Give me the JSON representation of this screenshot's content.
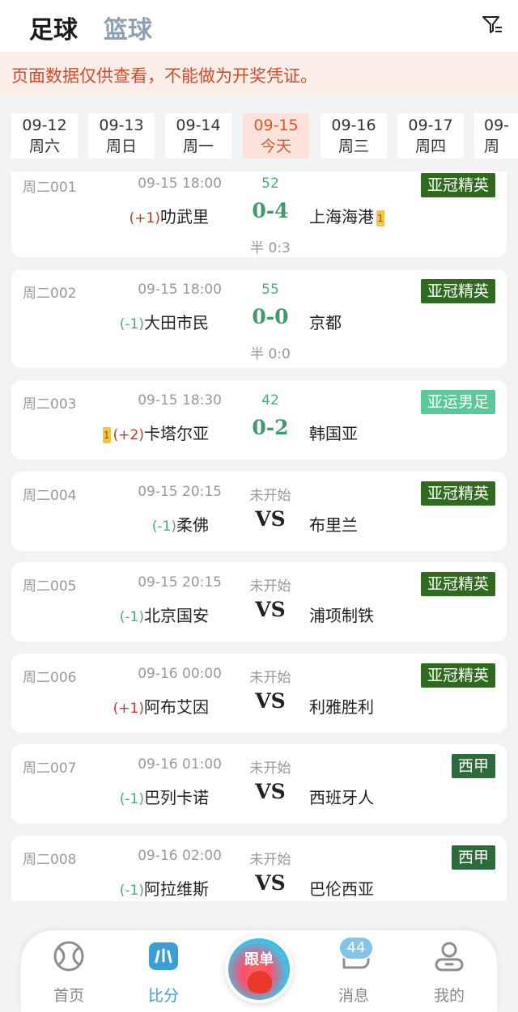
{
  "header": {
    "tab_active": "足球",
    "tab_inactive": "篮球"
  },
  "notice": "页面数据仅供查看，不能做为开奖凭证。",
  "dates": [
    {
      "date": "09-12",
      "day": "周六",
      "active": false
    },
    {
      "date": "09-13",
      "day": "周日",
      "active": false
    },
    {
      "date": "09-14",
      "day": "周一",
      "active": false
    },
    {
      "date": "09-15",
      "day": "今天",
      "active": true
    },
    {
      "date": "09-16",
      "day": "周三",
      "active": false
    },
    {
      "date": "09-17",
      "day": "周四",
      "active": false
    },
    {
      "date": "09-",
      "day": "周",
      "active": false
    }
  ],
  "matches": [
    {
      "code": "周二001",
      "time": "09-15 18:00",
      "status": "52",
      "league": "亚冠精英",
      "league_color": "#2f6b1f",
      "home_prefix_card": "",
      "handicap": "(+1)",
      "home": "叻武里",
      "score": "0-4",
      "away": "上海海港",
      "away_card": "1",
      "half": "半 0:3"
    },
    {
      "code": "周二002",
      "time": "09-15 18:00",
      "status": "55",
      "league": "亚冠精英",
      "league_color": "#2f6b1f",
      "home_prefix_card": "",
      "handicap": "(-1)",
      "home": "大田市民",
      "score": "0-0",
      "away": "京都",
      "away_card": "",
      "half": "半 0:0"
    },
    {
      "code": "周二003",
      "time": "09-15 18:30",
      "status": "42",
      "league": "亚运男足",
      "league_color": "#5bc89a",
      "home_prefix_card": "1",
      "handicap": "(+2)",
      "home": "卡塔尔亚",
      "score": "0-2",
      "away": "韩国亚",
      "away_card": "",
      "half": ""
    },
    {
      "code": "周二004",
      "time": "09-15 20:15",
      "status": "未开始",
      "league": "亚冠精英",
      "league_color": "#2f6b1f",
      "home_prefix_card": "",
      "handicap": "(-1)",
      "home": "柔佛",
      "score": "VS",
      "away": "布里兰",
      "away_card": "",
      "half": ""
    },
    {
      "code": "周二005",
      "time": "09-15 20:15",
      "status": "未开始",
      "league": "亚冠精英",
      "league_color": "#2f6b1f",
      "home_prefix_card": "",
      "handicap": "(-1)",
      "home": "北京国安",
      "score": "VS",
      "away": "浦项制铁",
      "away_card": "",
      "half": ""
    },
    {
      "code": "周二006",
      "time": "09-16 00:00",
      "status": "未开始",
      "league": "亚冠精英",
      "league_color": "#2f6b1f",
      "home_prefix_card": "",
      "handicap": "(+1)",
      "home": "阿布艾因",
      "score": "VS",
      "away": "利雅胜利",
      "away_card": "",
      "half": ""
    },
    {
      "code": "周二007",
      "time": "09-16 01:00",
      "status": "未开始",
      "league": "西甲",
      "league_color": "#2e6b3a",
      "home_prefix_card": "",
      "handicap": "(-1)",
      "home": "巴列卡诺",
      "score": "VS",
      "away": "西班牙人",
      "away_card": "",
      "half": ""
    },
    {
      "code": "周二008",
      "time": "09-16 02:00",
      "status": "未开始",
      "league": "西甲",
      "league_color": "#2e6b3a",
      "home_prefix_card": "",
      "handicap": "(-1)",
      "home": "阿拉维斯",
      "score": "VS",
      "away": "巴伦西亚",
      "away_card": "",
      "half": ""
    }
  ],
  "nav": {
    "home": "首页",
    "scores": "比分",
    "center": "跟单",
    "messages": "消息",
    "badge": "44",
    "mine": "我的"
  }
}
